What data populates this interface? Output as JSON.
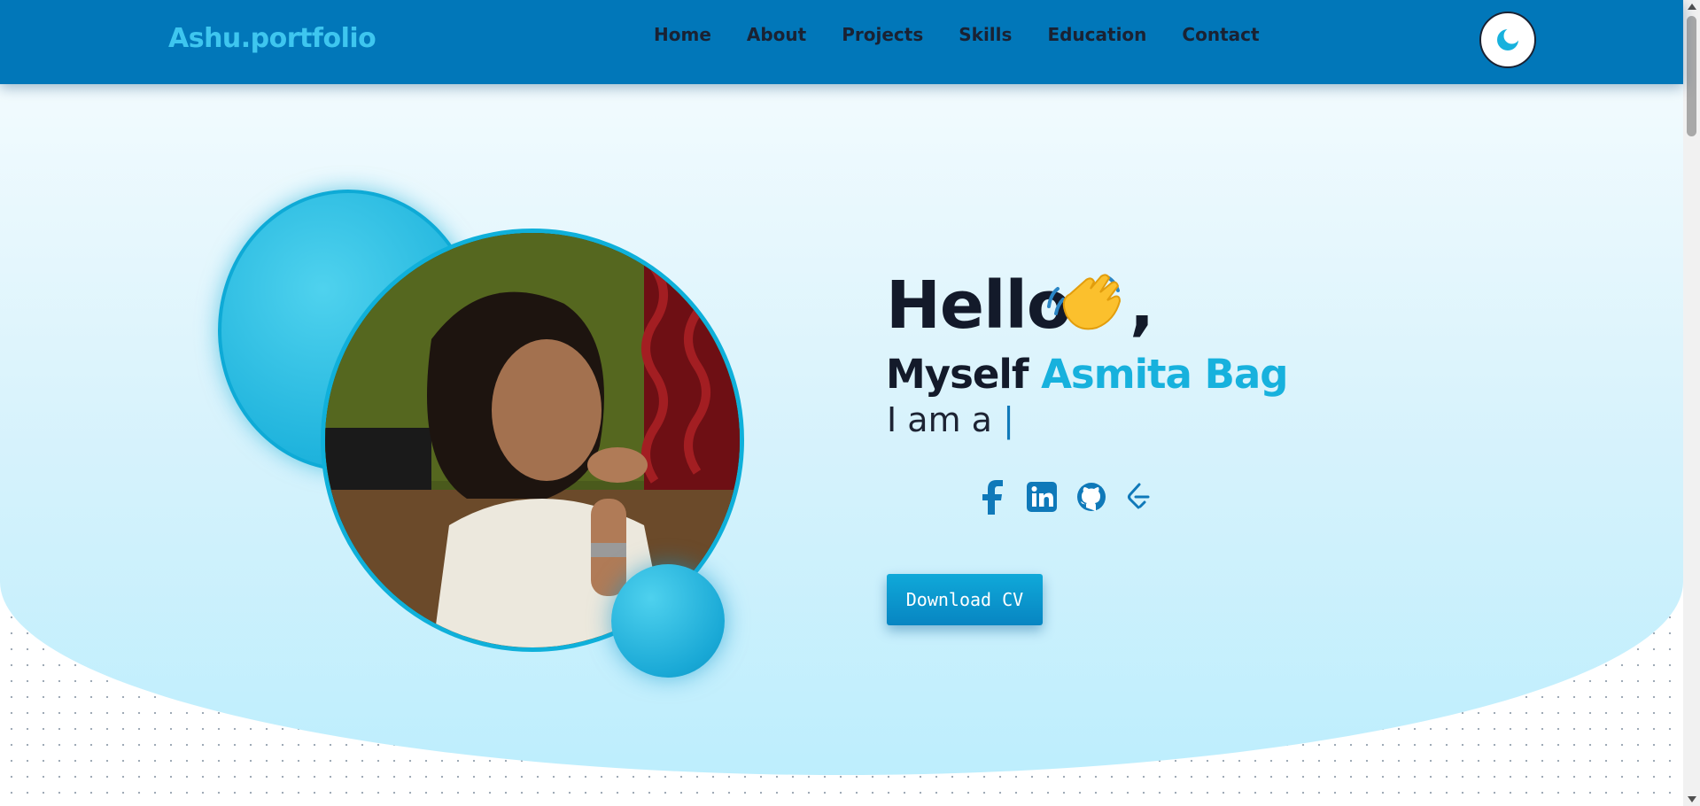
{
  "nav": {
    "brand": "Ashu.portfolio",
    "links": [
      "Home",
      "About",
      "Projects",
      "Skills",
      "Education",
      "Contact"
    ],
    "theme_toggle_icon": "moon-icon"
  },
  "hero": {
    "greeting": "Hello",
    "greeting_emoji_icon": "waving-hand-icon",
    "greeting_punct": ",",
    "intro_prefix": "Myself",
    "intro_name": "Asmita Bag",
    "role_prefix": "I am a",
    "cursor": "|",
    "photo_icon": "profile-photo",
    "socials": [
      "facebook-icon",
      "linkedin-icon",
      "github-icon",
      "leetcode-icon"
    ],
    "cv_button": "Download CV"
  },
  "colors": {
    "navbar": "#0177b9",
    "brand": "#3ec6ef",
    "accent": "#17b1dd",
    "text_dark": "#131a2a"
  }
}
